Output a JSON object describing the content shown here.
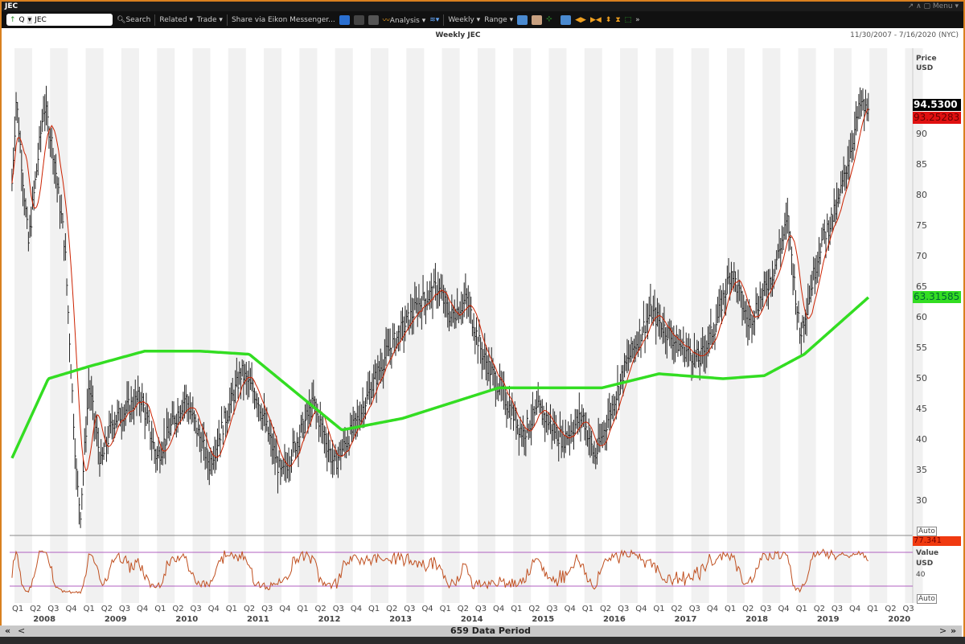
{
  "window": {
    "title": "JEC",
    "controls": "↗ ∧ ▢ Menu ▾"
  },
  "toolbar": {
    "ric_prefix": "Q",
    "ric": "JEC",
    "search": "Search",
    "related": "Related ▾",
    "trade": "Trade ▾",
    "share": "Share via Eikon Messenger...",
    "analysis": "Analysis ▾",
    "interval": "Weekly ▾",
    "range": "Range ▾"
  },
  "chart_header": {
    "title": "Weekly JEC",
    "range": "11/30/2007 - 7/16/2020 (NYC)"
  },
  "price_axis": {
    "label1": "Price",
    "label2": "USD",
    "auto": "Auto",
    "ticks": [
      "30",
      "35",
      "40",
      "45",
      "50",
      "55",
      "60",
      "65",
      "70",
      "75",
      "80",
      "85",
      "90"
    ]
  },
  "tags": {
    "last": "94.5300",
    "ma_short": "93.25283",
    "ma_long": "63.31585",
    "osc": "77.341"
  },
  "osc_axis": {
    "label1": "Value",
    "label2": "USD",
    "tick": "40",
    "auto": "Auto"
  },
  "time_axis": {
    "quarters": [
      "Q1",
      "Q2",
      "Q3",
      "Q4"
    ],
    "years": [
      "2008",
      "2009",
      "2010",
      "2011",
      "2012",
      "2013",
      "2014",
      "2015",
      "2016",
      "2017",
      "2018",
      "2019",
      "2020"
    ]
  },
  "footer": {
    "period": "659 Data Period",
    "first": "«",
    "prev": "<",
    "next": ">",
    "last": "»"
  },
  "colors": {
    "price": "#000000",
    "ma_short": "#cc2200",
    "ma_long": "#33dd22",
    "osc": "#c05020",
    "osc_bands": "#b060c0"
  },
  "chart_data": {
    "type": "line",
    "title": "Weekly JEC",
    "ylabel": "Price USD",
    "ylim": [
      25,
      101
    ],
    "price_path": [
      [
        2007.92,
        82
      ],
      [
        2007.98,
        96
      ],
      [
        2008.15,
        72
      ],
      [
        2008.37,
        95
      ],
      [
        2008.49,
        88
      ],
      [
        2008.66,
        72
      ],
      [
        2008.83,
        33
      ],
      [
        2008.88,
        28
      ],
      [
        2009.0,
        49
      ],
      [
        2009.17,
        36
      ],
      [
        2009.33,
        43
      ],
      [
        2009.73,
        47
      ],
      [
        2009.95,
        37
      ],
      [
        2010.35,
        47
      ],
      [
        2010.69,
        36
      ],
      [
        2011.14,
        51
      ],
      [
        2011.36,
        47
      ],
      [
        2011.7,
        34
      ],
      [
        2012.15,
        46
      ],
      [
        2012.44,
        36
      ],
      [
        2012.72,
        42
      ],
      [
        2013.17,
        54
      ],
      [
        2013.62,
        62
      ],
      [
        2013.9,
        65
      ],
      [
        2014.07,
        60
      ],
      [
        2014.3,
        63
      ],
      [
        2014.52,
        54
      ],
      [
        2015.09,
        41
      ],
      [
        2015.31,
        45
      ],
      [
        2015.65,
        40
      ],
      [
        2015.93,
        44
      ],
      [
        2016.1,
        37
      ],
      [
        2016.56,
        53
      ],
      [
        2016.89,
        61
      ],
      [
        2017.23,
        56
      ],
      [
        2017.57,
        53
      ],
      [
        2017.8,
        59
      ],
      [
        2018.02,
        68
      ],
      [
        2018.25,
        59
      ],
      [
        2018.59,
        67
      ],
      [
        2018.81,
        76
      ],
      [
        2018.98,
        57
      ],
      [
        2019.27,
        72
      ],
      [
        2019.5,
        78
      ],
      [
        2019.66,
        86
      ],
      [
        2019.83,
        95
      ],
      [
        2019.94,
        93.3
      ]
    ],
    "ma_long": [
      [
        2007.92,
        37
      ],
      [
        2008.43,
        50
      ],
      [
        2009.0,
        52
      ],
      [
        2009.78,
        54.5
      ],
      [
        2010.57,
        54.5
      ],
      [
        2011.25,
        54
      ],
      [
        2011.93,
        47.5
      ],
      [
        2012.55,
        41.6
      ],
      [
        2013.4,
        43.5
      ],
      [
        2014.75,
        48.5
      ],
      [
        2015.65,
        48.5
      ],
      [
        2016.2,
        48.5
      ],
      [
        2017.0,
        50.8
      ],
      [
        2017.9,
        50
      ],
      [
        2018.48,
        50.5
      ],
      [
        2019.04,
        54
      ],
      [
        2019.94,
        63.3
      ]
    ],
    "osc_bands": [
      80,
      20
    ],
    "osc_last": 77.341
  }
}
